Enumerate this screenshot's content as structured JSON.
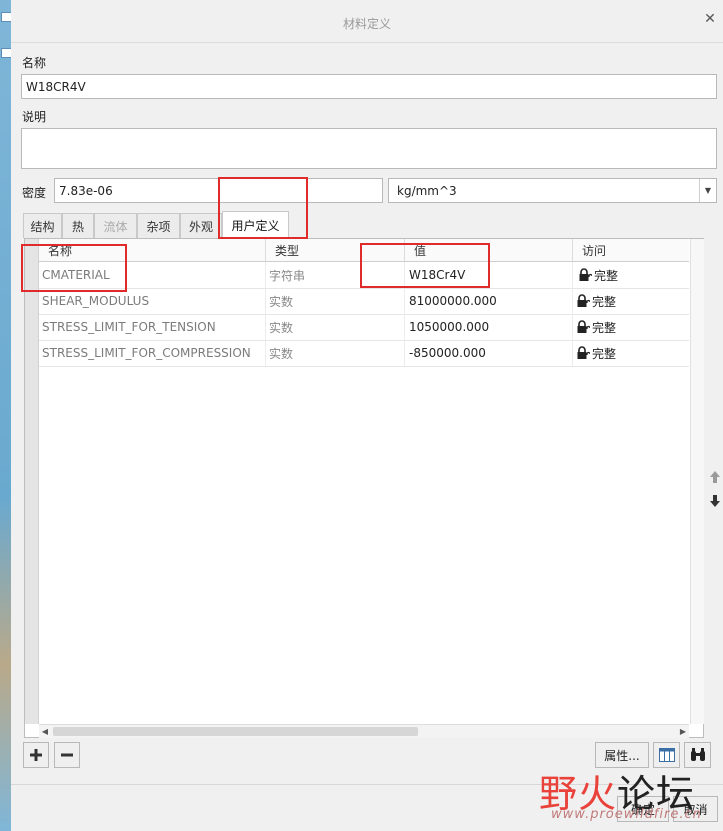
{
  "dialog": {
    "title": "材料定义"
  },
  "name": {
    "label": "名称",
    "value": "W18CR4V"
  },
  "description": {
    "label": "说明",
    "value": ""
  },
  "density": {
    "label": "密度",
    "value": "7.83e-06",
    "unit": "kg/mm^3"
  },
  "tabs": [
    {
      "label": "结构",
      "state": "normal"
    },
    {
      "label": "热",
      "state": "normal"
    },
    {
      "label": "流体",
      "state": "disabled"
    },
    {
      "label": "杂项",
      "state": "normal"
    },
    {
      "label": "外观",
      "state": "normal"
    },
    {
      "label": "用户定义",
      "state": "active"
    }
  ],
  "table": {
    "columns": [
      "名称",
      "类型",
      "值",
      "访问"
    ],
    "rows": [
      {
        "name": "CMATERIAL",
        "type": "字符串",
        "value": "W18Cr4V",
        "access": "完整"
      },
      {
        "name": "SHEAR_MODULUS",
        "type": "实数",
        "value": "81000000.000",
        "access": "完整"
      },
      {
        "name": "STRESS_LIMIT_FOR_TENSION",
        "type": "实数",
        "value": "1050000.000",
        "access": "完整"
      },
      {
        "name": "STRESS_LIMIT_FOR_COMPRESSION",
        "type": "实数",
        "value": "-850000.000",
        "access": "完整"
      }
    ]
  },
  "buttons": {
    "properties": "属性...",
    "ok": "确定",
    "cancel": "取消"
  },
  "watermark": {
    "text": "野火论坛",
    "url": "www.proewildfire.cn"
  },
  "icons": {
    "add": "plus-icon",
    "remove": "minus-icon",
    "table": "table-columns-icon",
    "search": "binoculars-icon",
    "lock": "lock-icon",
    "up": "arrow-up-icon",
    "down": "arrow-down-icon",
    "close": "close-icon"
  },
  "colors": {
    "annotation": "#e02b2b",
    "watermark_red": "#e8423a",
    "watermark_dark": "#222222"
  }
}
